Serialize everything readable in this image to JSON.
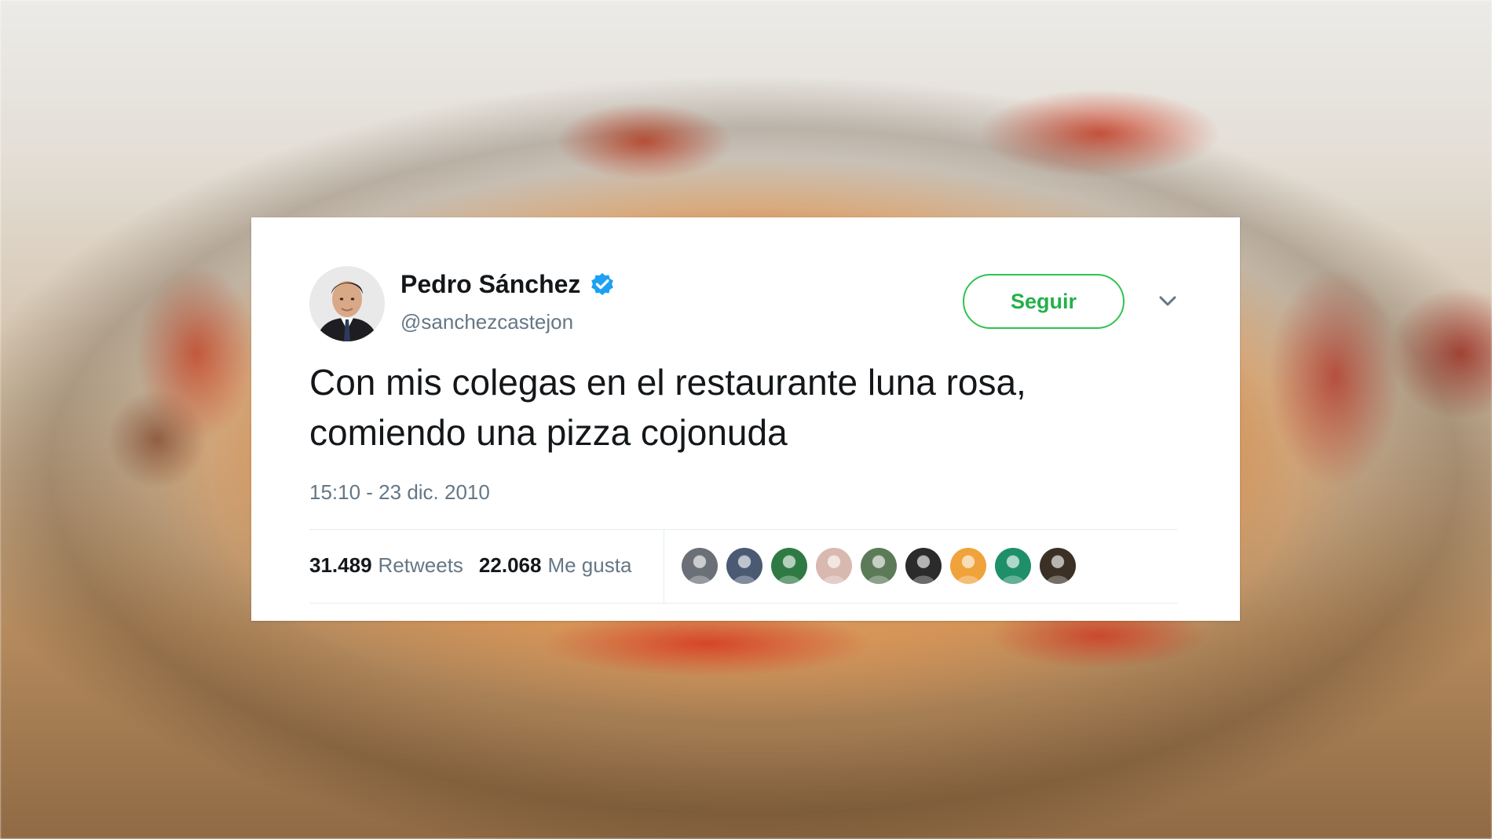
{
  "tweet": {
    "display_name": "Pedro Sánchez",
    "handle": "@sanchezcastejon",
    "follow_label": "Seguir",
    "text_line1": "Con mis colegas en el restaurante luna rosa,",
    "text_line2": "comiendo una pizza cojonuda",
    "timestamp": "15:10 - 23 dic. 2010",
    "retweets_count": "31.489",
    "retweets_label": "Retweets",
    "likes_count": "22.068",
    "likes_label": "Me gusta",
    "verified_icon": "verified-badge-icon",
    "menu_icon": "chevron-down-icon"
  },
  "colors": {
    "follow_accent": "#2fc34f",
    "verified": "#1da1f2",
    "text_primary": "#14171a",
    "text_secondary": "#657786"
  },
  "likers": [
    {
      "name": "liker-avatar-1",
      "color": "#6b7076"
    },
    {
      "name": "liker-avatar-2",
      "color": "#4a5a72"
    },
    {
      "name": "liker-avatar-3",
      "color": "#2f7a44"
    },
    {
      "name": "liker-avatar-4",
      "color": "#d9b8b0"
    },
    {
      "name": "liker-avatar-5",
      "color": "#5c7a58"
    },
    {
      "name": "liker-avatar-6",
      "color": "#2b2b2b"
    },
    {
      "name": "liker-avatar-7",
      "color": "#f0a23b"
    },
    {
      "name": "liker-avatar-8",
      "color": "#1f8f6a"
    },
    {
      "name": "liker-avatar-9",
      "color": "#3a3026"
    }
  ]
}
